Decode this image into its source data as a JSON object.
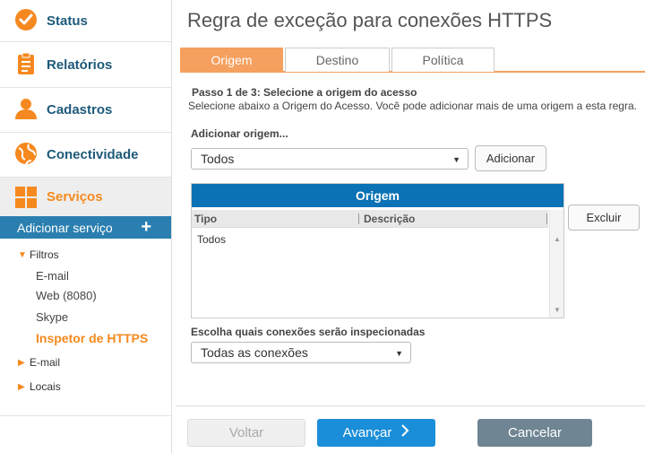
{
  "sidebar": {
    "nav": [
      {
        "label": "Status",
        "icon": "check-circle-icon"
      },
      {
        "label": "Relatórios",
        "icon": "clipboard-icon"
      },
      {
        "label": "Cadastros",
        "icon": "user-icon"
      },
      {
        "label": "Conectividade",
        "icon": "globe-icon"
      },
      {
        "label": "Serviços",
        "icon": "grid-icon"
      }
    ],
    "add_service": {
      "label": "Adicionar serviço",
      "plus": "+"
    },
    "tree": {
      "filtros": {
        "label": "Filtros",
        "children": [
          "E-mail",
          "Web (8080)",
          "Skype",
          "Inspetor de HTTPS"
        ]
      },
      "email": {
        "label": "E-mail"
      },
      "locais": {
        "label": "Locais"
      }
    }
  },
  "main": {
    "title": "Regra de exceção para conexões HTTPS",
    "tabs": [
      {
        "label": "Origem"
      },
      {
        "label": "Destino"
      },
      {
        "label": "Política"
      }
    ],
    "step_title": "Passo 1 de 3: Selecione a origem do acesso",
    "step_desc": "Selecione abaixo a Origem do Acesso. Você pode adicionar mais de uma origem a esta regra.",
    "add_origin_label": "Adicionar origem...",
    "origin_select": {
      "value": "Todos"
    },
    "add_button": "Adicionar",
    "grid": {
      "title": "Origem",
      "columns": [
        "Tipo",
        "Descrição"
      ],
      "rows": [
        {
          "tipo": "Todos",
          "descricao": ""
        }
      ]
    },
    "delete_button": "Excluir",
    "connections_label": "Escolha quais conexões serão inspecionadas",
    "connections_select": {
      "value": "Todas as conexões"
    },
    "footer": {
      "back": "Voltar",
      "next": "Avançar",
      "cancel": "Cancelar"
    }
  },
  "colors": {
    "accent_orange": "#f5891f",
    "nav_blue": "#1e5a7a",
    "grid_header_blue": "#0b72b5",
    "next_button_blue": "#1a8ed8",
    "cancel_button_gray": "#6f8593"
  }
}
